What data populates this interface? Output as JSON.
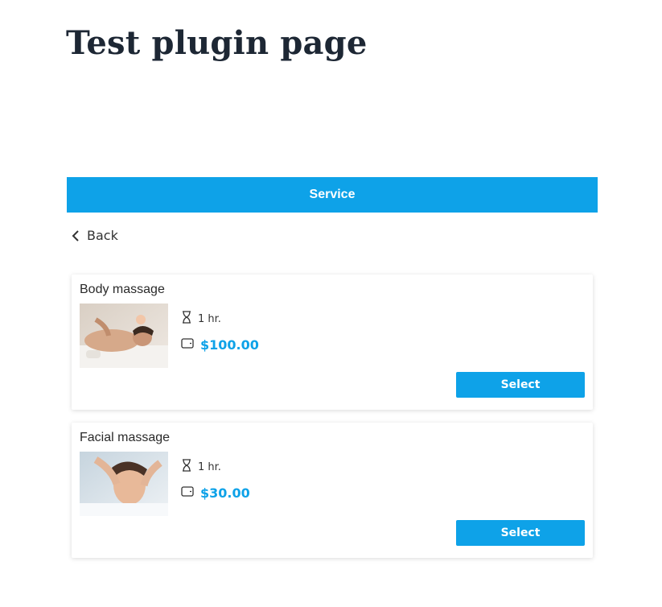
{
  "page": {
    "title": "Test plugin page"
  },
  "header": {
    "service_label": "Service"
  },
  "nav": {
    "back_label": "Back"
  },
  "services": [
    {
      "name": "Body massage",
      "duration": "1 hr.",
      "price": "$100.00",
      "select_label": "Select"
    },
    {
      "name": "Facial massage",
      "duration": "1 hr.",
      "price": "$30.00",
      "select_label": "Select"
    }
  ],
  "icons": {
    "back": "chevron-left-icon",
    "duration": "hourglass-icon",
    "price": "wallet-icon"
  },
  "colors": {
    "accent": "#0ea2e8",
    "title": "#1d2734"
  }
}
